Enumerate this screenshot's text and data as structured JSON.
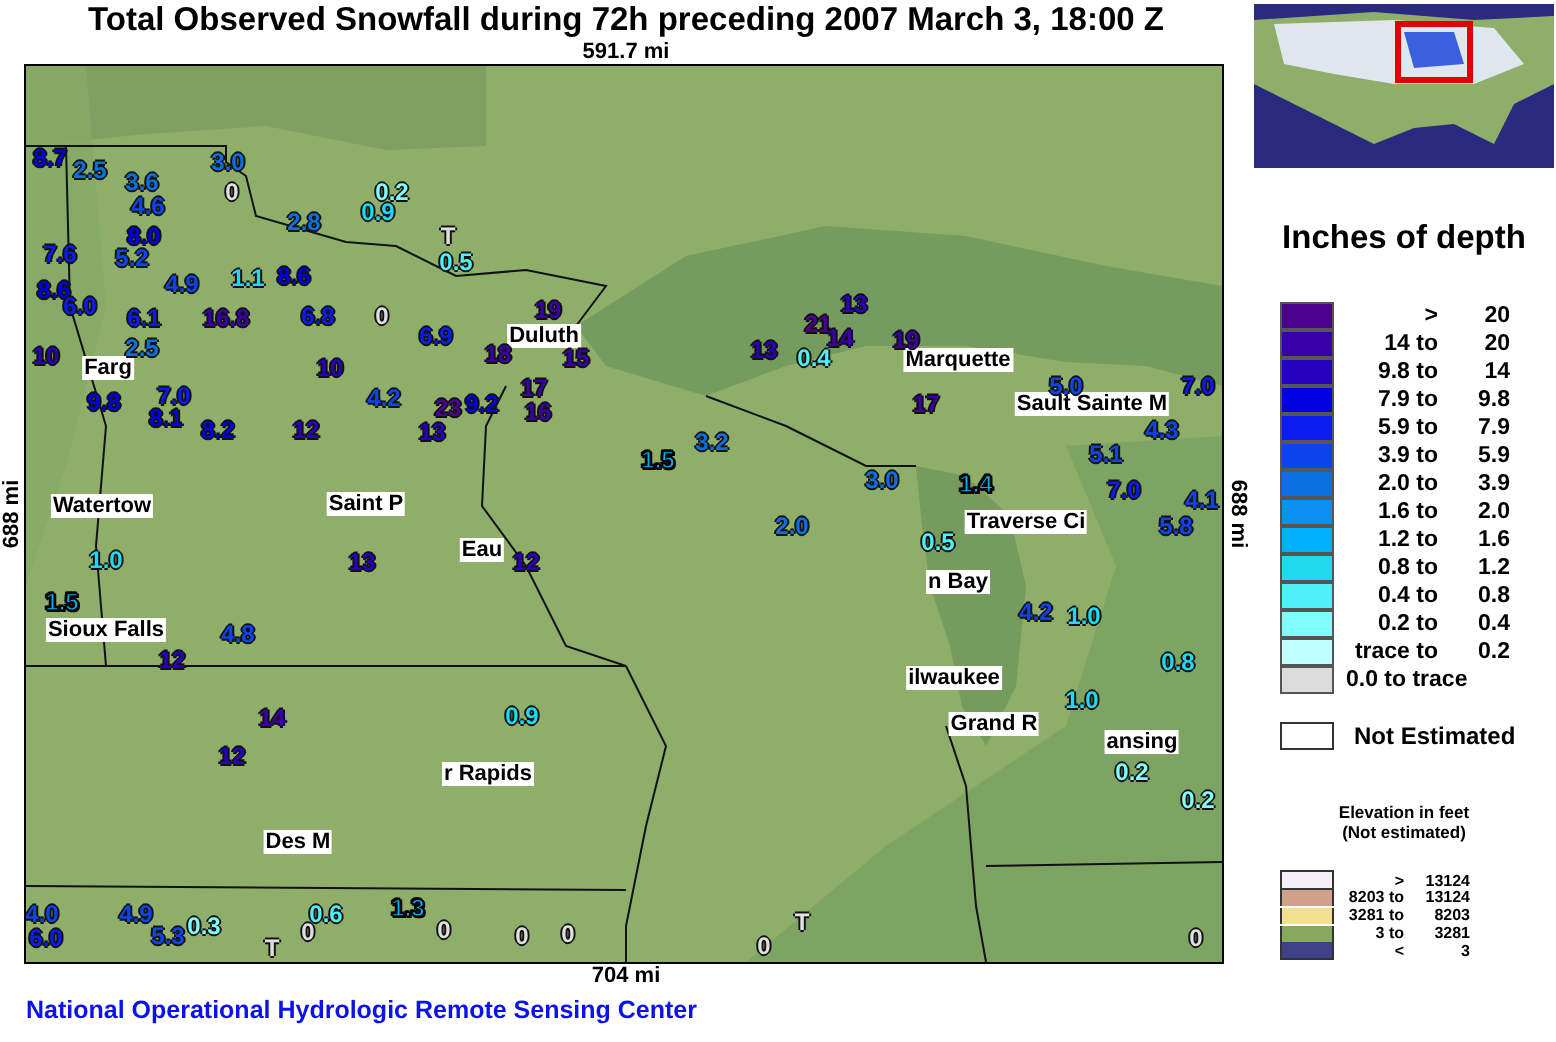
{
  "title": "Total Observed Snowfall during 72h preceding 2007 March 3, 18:00 Z",
  "map": {
    "top_scale": "591.7 mi",
    "bottom_scale": "704 mi",
    "left_scale": "688 mi",
    "right_scale": "688 mi",
    "cities": [
      {
        "name": "Duluth"
      },
      {
        "name": "Marquette"
      },
      {
        "name": "Sault Sainte M"
      },
      {
        "name": "Farg"
      },
      {
        "name": "Watertow"
      },
      {
        "name": "Saint P"
      },
      {
        "name": "Eau"
      },
      {
        "name": "Traverse Ci"
      },
      {
        "name": "n Bay"
      },
      {
        "name": "ilwaukee"
      },
      {
        "name": "Grand R"
      },
      {
        "name": "ansing"
      },
      {
        "name": "Sioux Falls"
      },
      {
        "name": "r Rapids"
      },
      {
        "name": "Des M"
      }
    ],
    "stations": [
      {
        "value": "3.0",
        "color": "#0a70e0"
      },
      {
        "value": "0",
        "color": "#e0e0e0"
      },
      {
        "value": "3.6",
        "color": "#0a70e0"
      },
      {
        "value": "4.6",
        "color": "#0a45f0"
      },
      {
        "value": "8.0",
        "color": "#0000e0"
      },
      {
        "value": "5.2",
        "color": "#0a45f0"
      },
      {
        "value": "4.9",
        "color": "#0a45f0"
      },
      {
        "value": "1.1",
        "color": "#20d8f0"
      },
      {
        "value": "2.8",
        "color": "#0a70e0"
      },
      {
        "value": "8.6",
        "color": "#0000e0"
      },
      {
        "value": "6.8",
        "color": "#0a1cf0"
      },
      {
        "value": "0",
        "color": "#e0e0e0"
      },
      {
        "value": "6.9",
        "color": "#0a1cf0"
      },
      {
        "value": "0.2",
        "color": "#80ffff"
      },
      {
        "value": "0.9",
        "color": "#20d8f0"
      },
      {
        "value": "T",
        "color": "#e0e0e0"
      },
      {
        "value": "0.5",
        "color": "#50f0f8"
      },
      {
        "value": "6.1",
        "color": "#0a1cf0"
      },
      {
        "value": "16.8",
        "color": "#3a00a8"
      },
      {
        "value": "10",
        "color": "#2800c0"
      },
      {
        "value": "19",
        "color": "#3a00a8"
      },
      {
        "value": "18",
        "color": "#3a00a8"
      },
      {
        "value": "15",
        "color": "#3a00a8"
      },
      {
        "value": "10",
        "color": "#2800c0"
      },
      {
        "value": "4.2",
        "color": "#0a45f0"
      },
      {
        "value": "8.2",
        "color": "#0000e0"
      },
      {
        "value": "12",
        "color": "#2800c0"
      },
      {
        "value": "7.0",
        "color": "#0a1cf0"
      },
      {
        "value": "8.1",
        "color": "#0000e0"
      },
      {
        "value": "9.8",
        "color": "#0000e0"
      },
      {
        "value": "2.5",
        "color": "#0a70e0"
      },
      {
        "value": "13",
        "color": "#2800c0"
      },
      {
        "value": "23",
        "color": "#4b0090"
      },
      {
        "value": "9.2",
        "color": "#0000e0"
      },
      {
        "value": "17",
        "color": "#3a00a8"
      },
      {
        "value": "16",
        "color": "#3a00a8"
      },
      {
        "value": "8.7",
        "color": "#0000e0"
      },
      {
        "value": "2.5",
        "color": "#0a70e0"
      },
      {
        "value": "7.6",
        "color": "#0a1cf0"
      },
      {
        "value": "8.6",
        "color": "#0000e0"
      },
      {
        "value": "6.0",
        "color": "#0a1cf0"
      },
      {
        "value": "13",
        "color": "#2800c0"
      },
      {
        "value": "21",
        "color": "#4b0090"
      },
      {
        "value": "14",
        "color": "#3a00a8"
      },
      {
        "value": "13",
        "color": "#2800c0"
      },
      {
        "value": "0.4",
        "color": "#50f0f8"
      },
      {
        "value": "19",
        "color": "#3a00a8"
      },
      {
        "value": "17",
        "color": "#3a00a8"
      },
      {
        "value": "5.0",
        "color": "#0a45f0"
      },
      {
        "value": "7.0",
        "color": "#0a1cf0"
      },
      {
        "value": "4.3",
        "color": "#0a45f0"
      },
      {
        "value": "5.1",
        "color": "#0a45f0"
      },
      {
        "value": "7.0",
        "color": "#0a1cf0"
      },
      {
        "value": "5.8",
        "color": "#0a45f0"
      },
      {
        "value": "4.1",
        "color": "#0a45f0"
      },
      {
        "value": "3.0",
        "color": "#0a70e0"
      },
      {
        "value": "1.4",
        "color": "#00b0f8"
      },
      {
        "value": "2.0",
        "color": "#0a70e0"
      },
      {
        "value": "1.5",
        "color": "#00b0f8"
      },
      {
        "value": "3.2",
        "color": "#0a70e0"
      },
      {
        "value": "0.5",
        "color": "#50f0f8"
      },
      {
        "value": "4.2",
        "color": "#0a45f0"
      },
      {
        "value": "1.0",
        "color": "#20d8f0"
      },
      {
        "value": "1.0",
        "color": "#20d8f0"
      },
      {
        "value": "0.2",
        "color": "#80ffff"
      },
      {
        "value": "0.8",
        "color": "#20d8f0"
      },
      {
        "value": "14",
        "color": "#3a00a8"
      },
      {
        "value": "12",
        "color": "#2800c0"
      },
      {
        "value": "4.0",
        "color": "#0a45f0"
      },
      {
        "value": "6.0",
        "color": "#0a1cf0"
      },
      {
        "value": "4.9",
        "color": "#0a45f0"
      },
      {
        "value": "5.3",
        "color": "#0a45f0"
      },
      {
        "value": "0.3",
        "color": "#80ffff"
      },
      {
        "value": "T",
        "color": "#e0e0e0"
      },
      {
        "value": "0",
        "color": "#e0e0e0"
      },
      {
        "value": "0.6",
        "color": "#50f0f8"
      },
      {
        "value": "0",
        "color": "#e0e0e0"
      },
      {
        "value": "0",
        "color": "#e0e0e0"
      },
      {
        "value": "0",
        "color": "#e0e0e0"
      },
      {
        "value": "0",
        "color": "#e0e0e0"
      },
      {
        "value": "T",
        "color": "#e0e0e0"
      },
      {
        "value": "0.2",
        "color": "#80ffff"
      },
      {
        "value": "0",
        "color": "#e0e0e0"
      },
      {
        "value": "12",
        "color": "#2800c0"
      },
      {
        "value": "1.5",
        "color": "#00b0f8"
      },
      {
        "value": "4.8",
        "color": "#0a45f0"
      },
      {
        "value": "1.0",
        "color": "#20d8f0"
      },
      {
        "value": "13",
        "color": "#2800c0"
      },
      {
        "value": "12",
        "color": "#2800c0"
      },
      {
        "value": "0.9",
        "color": "#20d8f0"
      },
      {
        "value": "1.3",
        "color": "#00b0f8"
      }
    ]
  },
  "legend": {
    "title": "Inches of depth",
    "items": [
      {
        "from": ">",
        "to": "20",
        "color": "#4b0090"
      },
      {
        "from": "14 to",
        "to": "20",
        "color": "#3a00a8"
      },
      {
        "from": "9.8 to",
        "to": "14",
        "color": "#2800c0"
      },
      {
        "from": "7.9 to",
        "to": "9.8",
        "color": "#0000e0"
      },
      {
        "from": "5.9 to",
        "to": "7.9",
        "color": "#0a1cf0"
      },
      {
        "from": "3.9 to",
        "to": "5.9",
        "color": "#0a45f0"
      },
      {
        "from": "2.0 to",
        "to": "3.9",
        "color": "#0a70e0"
      },
      {
        "from": "1.6 to",
        "to": "2.0",
        "color": "#0a90f0"
      },
      {
        "from": "1.2 to",
        "to": "1.6",
        "color": "#00b0f8"
      },
      {
        "from": "0.8 to",
        "to": "1.2",
        "color": "#20d8f0"
      },
      {
        "from": "0.4 to",
        "to": "0.8",
        "color": "#50f0f8"
      },
      {
        "from": "0.2 to",
        "to": "0.4",
        "color": "#80ffff"
      },
      {
        "from": "trace to",
        "to": "0.2",
        "color": "#c0ffff"
      },
      {
        "from": "0.0 to trace",
        "color": "#dcdcdc"
      }
    ],
    "not_estimated": "Not Estimated"
  },
  "elevation_legend": {
    "title": "Elevation in feet",
    "subtitle": "(Not estimated)",
    "items": [
      {
        "from": ">",
        "to": "13124",
        "color": "#f8eef8"
      },
      {
        "from": "8203 to",
        "to": "13124",
        "color": "#d0a088"
      },
      {
        "from": "3281 to",
        "to": "8203",
        "color": "#f0e090"
      },
      {
        "from": "3 to",
        "to": "3281",
        "color": "#88a860"
      },
      {
        "from": "<",
        "to": "3",
        "color": "#404088"
      }
    ]
  },
  "credit": "National Operational Hydrologic Remote Sensing Center"
}
